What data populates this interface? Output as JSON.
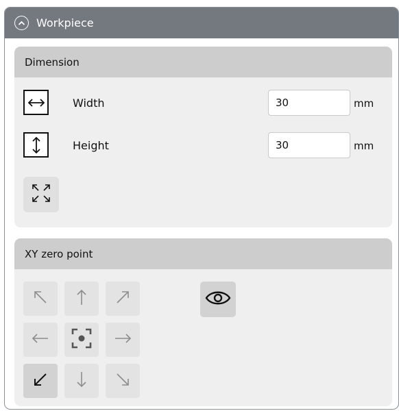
{
  "panel": {
    "title": "Workpiece",
    "collapsed": false
  },
  "dimension": {
    "title": "Dimension",
    "width": {
      "label": "Width",
      "value": "30",
      "unit": "mm",
      "icon": "horizontal-arrows-icon"
    },
    "height": {
      "label": "Height",
      "value": "30",
      "unit": "mm",
      "icon": "vertical-arrows-icon"
    },
    "expand_icon": "expand-arrows-icon"
  },
  "xy_zero": {
    "title": "XY zero point",
    "buttons": [
      {
        "name": "top-left",
        "icon": "arrow-up-left-icon"
      },
      {
        "name": "top",
        "icon": "arrow-up-icon"
      },
      {
        "name": "top-right",
        "icon": "arrow-up-right-icon"
      },
      {
        "name": "left",
        "icon": "arrow-left-icon"
      },
      {
        "name": "center",
        "icon": "center-target-icon"
      },
      {
        "name": "right",
        "icon": "arrow-right-icon"
      },
      {
        "name": "bottom-left",
        "icon": "arrow-down-left-icon"
      },
      {
        "name": "bottom",
        "icon": "arrow-down-icon"
      },
      {
        "name": "bottom-right",
        "icon": "arrow-down-right-icon"
      }
    ],
    "selected": "bottom-left",
    "eye_icon": "eye-icon"
  },
  "colors": {
    "panel_header": "#74787f",
    "section_header": "#cdcdcd",
    "section_body": "#efefef",
    "icon_active": "#111111",
    "icon_inactive": "#8c8c8c"
  }
}
